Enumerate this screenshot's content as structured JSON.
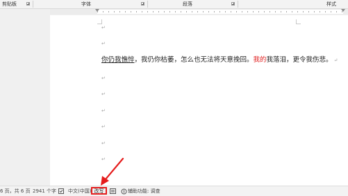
{
  "ribbon": {
    "clipboard_label": "剪贴板",
    "font_label": "字体",
    "paragraph_label": "段落",
    "styles_label": "样式"
  },
  "document": {
    "segment_underlined": "你仍我憔悴",
    "segment_normal_1": "，我仍你枯萎，怎么也无法将天意挽回。",
    "segment_red": "我的",
    "segment_normal_2": "我落泪，更令我伤悲。",
    "paragraph_mark": "↵"
  },
  "statusbar": {
    "page_info": "6 页，共 6 页",
    "word_count": "2941 个字",
    "language": "中文(中国)",
    "overtype": "改写",
    "accessibility": "辅助功能: 调查"
  },
  "colors": {
    "annotation_red": "#e51c1c",
    "revision_red": "#e02020"
  },
  "icons": [
    "dialog-launcher-icon",
    "proofing-icon",
    "macro-icon",
    "accessibility-icon",
    "annotation-arrow"
  ]
}
